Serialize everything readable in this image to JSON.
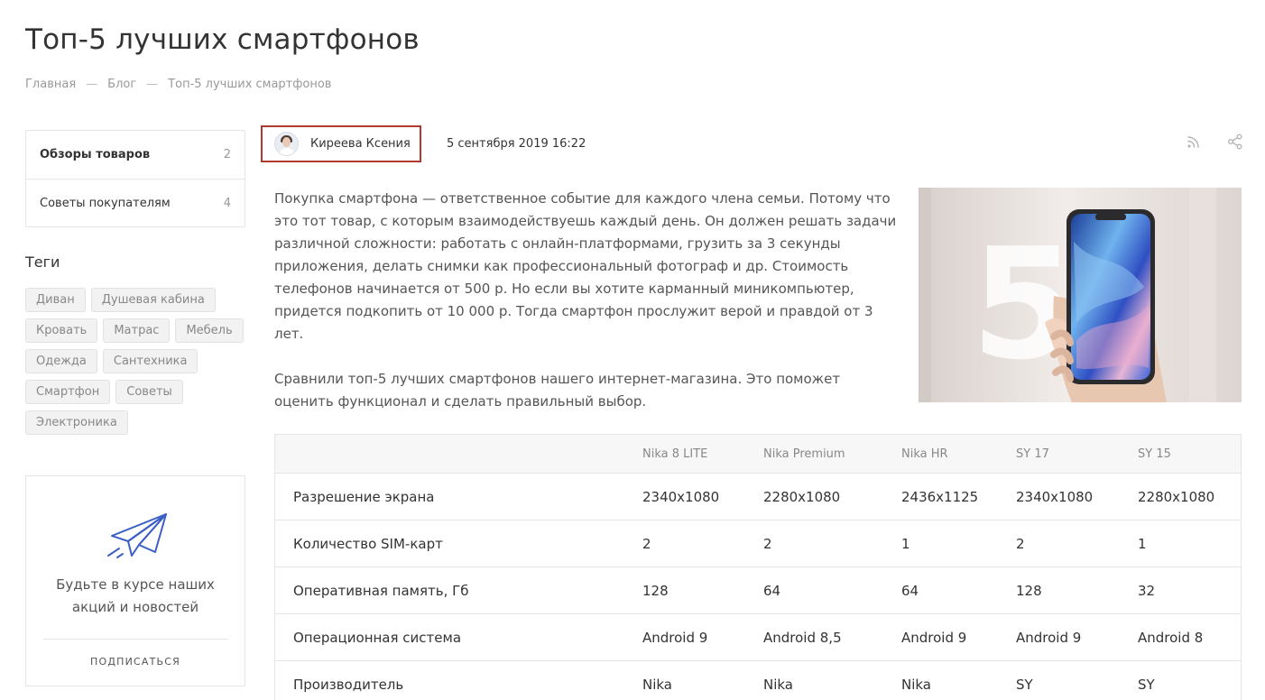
{
  "page": {
    "title": "Топ-5 лучших смартфонов",
    "breadcrumbs": [
      "Главная",
      "Блог",
      "Топ-5 лучших смартфонов"
    ]
  },
  "sidebar": {
    "categories": [
      {
        "label": "Обзоры товаров",
        "count": "2",
        "active": true
      },
      {
        "label": "Советы покупателям",
        "count": "4",
        "active": false
      }
    ],
    "tags_title": "Теги",
    "tags": [
      "Диван",
      "Душевая кабина",
      "Кровать",
      "Матрас",
      "Мебель",
      "Одежда",
      "Сантехника",
      "Смартфон",
      "Советы",
      "Электроника"
    ],
    "subscribe": {
      "text": "Будьте в курсе наших акций и новостей",
      "link": "ПОДПИСАТЬСЯ"
    }
  },
  "post": {
    "author": "Киреева Ксения",
    "date": "5 сентября 2019 16:22",
    "paragraphs": [
      "Покупка смартфона — ответственное событие для каждого члена семьи. Потому что это тот товар, с которым взаимодействуешь каждый день. Он должен решать задачи различной сложности: работать с онлайн-платформами, грузить за 3 секунды приложения, делать снимки как профессиональный фотограф и др. Стоимость телефонов начинается от 500 р. Но если вы хотите карманный миникомпьютер, придется подкопить от 10 000 р. Тогда смартфон прослужит верой и правдой от 3 лет.",
      "Сравнили топ-5 лучших смартфонов нашего интернет-магазина. Это поможет оценить функционал и сделать правильный выбор."
    ],
    "icons": [
      "rss-icon",
      "share-icon"
    ],
    "image_numeral": "5"
  },
  "table": {
    "headers": [
      "",
      "Nika 8 LITE",
      "Nika Premium",
      "Nika HR",
      "SY 17",
      "SY 15"
    ],
    "rows": [
      [
        "Разрешение экрана",
        "2340x1080",
        "2280x1080",
        "2436x1125",
        "2340x1080",
        "2280x1080"
      ],
      [
        "Количество SIM-карт",
        "2",
        "2",
        "1",
        "2",
        "1"
      ],
      [
        "Оперативная память, Гб",
        "128",
        "64",
        "64",
        "128",
        "32"
      ],
      [
        "Операционная система",
        "Android 9",
        "Android 8,5",
        "Android 9",
        "Android 9",
        "Android 8"
      ],
      [
        "Производитель",
        "Nika",
        "Nika",
        "Nika",
        "SY",
        "SY"
      ]
    ]
  },
  "colors": {
    "highlight_border": "#b03a2e",
    "icon_blue": "#3b5fc4"
  }
}
